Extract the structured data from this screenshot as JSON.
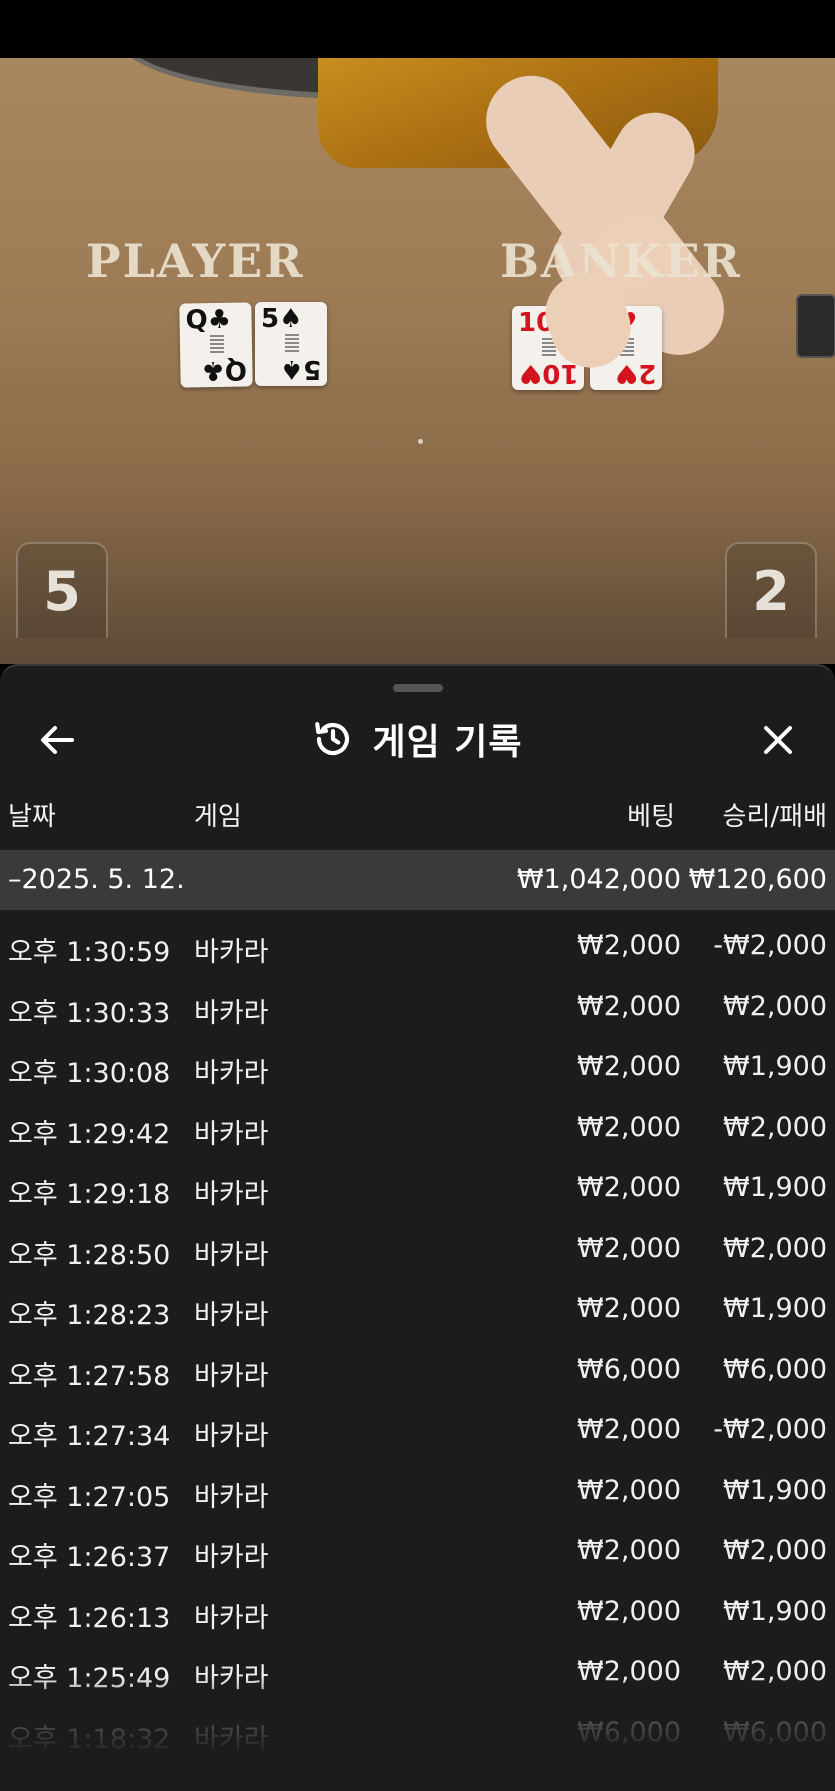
{
  "video": {
    "table_labels": {
      "player": "PLAYER",
      "banker": "BANKER"
    },
    "player_cards": [
      {
        "rank": "Q",
        "suit": "♣",
        "color": "black"
      },
      {
        "rank": "5",
        "suit": "♠",
        "color": "black"
      }
    ],
    "banker_cards": [
      {
        "rank": "10",
        "suit": "♥",
        "color": "red"
      },
      {
        "rank": "2",
        "suit": "♥",
        "color": "red"
      }
    ],
    "player_score": "5",
    "banker_score": "2"
  },
  "sheet": {
    "title": "게임 기록",
    "icons": {
      "back": "arrow-left-icon",
      "history": "history-icon",
      "close": "close-icon"
    },
    "columns": {
      "date": "날짜",
      "game": "게임",
      "bet": "베팅",
      "win_loss": "승리/패배"
    },
    "summary": {
      "date": "–2025. 5. 12.",
      "bet": "₩1,042,000",
      "win_loss": "₩120,600"
    },
    "rows": [
      {
        "time": "오후 1:30:59",
        "game": "바카라",
        "bet": "₩2,000",
        "win_loss": "-₩2,000"
      },
      {
        "time": "오후 1:30:33",
        "game": "바카라",
        "bet": "₩2,000",
        "win_loss": "₩2,000"
      },
      {
        "time": "오후 1:30:08",
        "game": "바카라",
        "bet": "₩2,000",
        "win_loss": "₩1,900"
      },
      {
        "time": "오후 1:29:42",
        "game": "바카라",
        "bet": "₩2,000",
        "win_loss": "₩2,000"
      },
      {
        "time": "오후 1:29:18",
        "game": "바카라",
        "bet": "₩2,000",
        "win_loss": "₩1,900"
      },
      {
        "time": "오후 1:28:50",
        "game": "바카라",
        "bet": "₩2,000",
        "win_loss": "₩2,000"
      },
      {
        "time": "오후 1:28:23",
        "game": "바카라",
        "bet": "₩2,000",
        "win_loss": "₩1,900"
      },
      {
        "time": "오후 1:27:58",
        "game": "바카라",
        "bet": "₩6,000",
        "win_loss": "₩6,000"
      },
      {
        "time": "오후 1:27:34",
        "game": "바카라",
        "bet": "₩2,000",
        "win_loss": "-₩2,000"
      },
      {
        "time": "오후 1:27:05",
        "game": "바카라",
        "bet": "₩2,000",
        "win_loss": "₩1,900"
      },
      {
        "time": "오후 1:26:37",
        "game": "바카라",
        "bet": "₩2,000",
        "win_loss": "₩2,000"
      },
      {
        "time": "오후 1:26:13",
        "game": "바카라",
        "bet": "₩2,000",
        "win_loss": "₩1,900"
      },
      {
        "time": "오후 1:25:49",
        "game": "바카라",
        "bet": "₩2,000",
        "win_loss": "₩2,000"
      },
      {
        "time": "오후 1:18:32",
        "game": "바카라",
        "bet": "₩6,000",
        "win_loss": "₩6,000"
      }
    ]
  },
  "colors": {
    "sheet_bg": "#1c1c1c",
    "summary_bg": "#3a3a3a",
    "text": "#ffffff"
  }
}
